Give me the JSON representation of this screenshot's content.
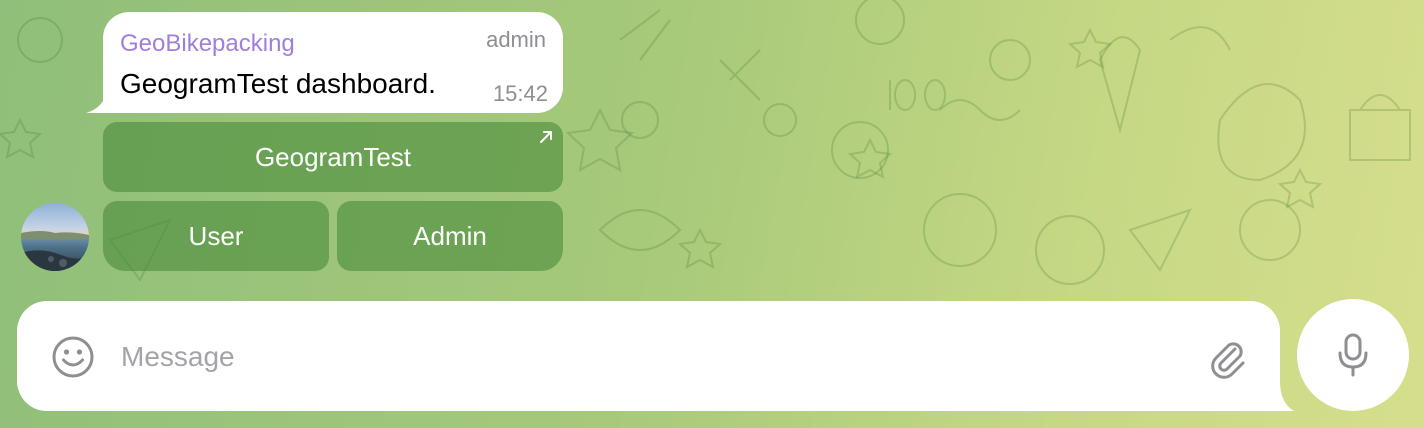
{
  "message": {
    "sender": "GeoBikepacking",
    "role": "admin",
    "text": "GeogramTest dashboard.",
    "time": "15:42"
  },
  "keyboard": {
    "row1": "GeogramTest",
    "user": "User",
    "admin": "Admin"
  },
  "composer": {
    "placeholder": "Message"
  },
  "icons": {
    "emoji": "emoji-icon",
    "attach": "paperclip-icon",
    "mic": "microphone-icon",
    "external": "external-link-arrow-icon"
  },
  "colors": {
    "sender_name": "#a07fdc",
    "keyboard_button": "#4c8c3c",
    "background_left": "#8fbf7a",
    "background_right": "#d6de8c"
  }
}
